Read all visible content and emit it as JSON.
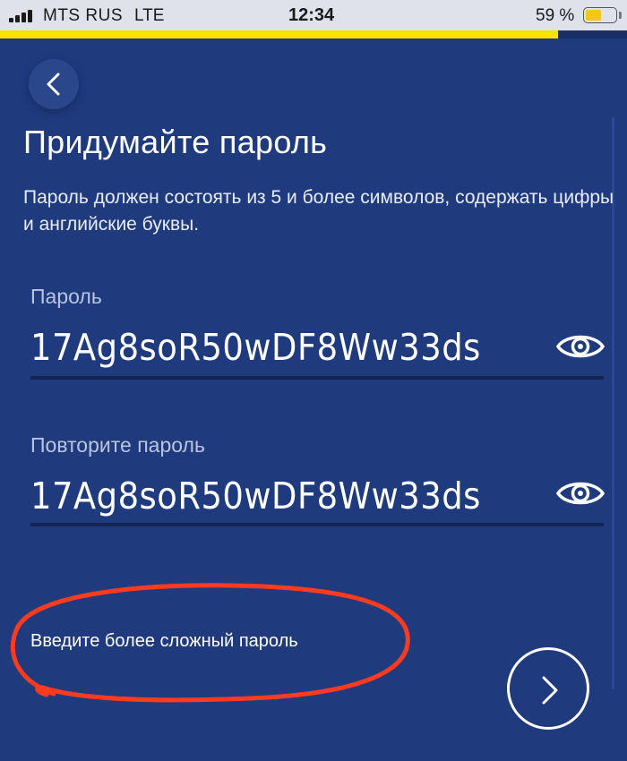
{
  "status_bar": {
    "carrier": "MTS RUS",
    "network": "LTE",
    "time": "12:34",
    "battery_percent": "59 %",
    "battery_level": 0.59
  },
  "progress": {
    "fraction": 0.89
  },
  "colors": {
    "background": "#1f3b7e",
    "accent": "#ffe200",
    "annotation": "#ff3b1f"
  },
  "back_button": {
    "icon": "chevron-left-icon"
  },
  "screen": {
    "title": "Придумайте пароль",
    "hint": "Пароль должен состоять из 5 и более символов, содержать цифры и английские буквы."
  },
  "password_field": {
    "label": "Пароль",
    "value": "17Ag8soR50wDF8Ww33ds",
    "toggle_icon": "eye-icon"
  },
  "repeat_field": {
    "label": "Повторите пароль",
    "value": "17Ag8soR50wDF8Ww33ds",
    "toggle_icon": "eye-icon"
  },
  "error": {
    "message": "Введите более сложный пароль"
  },
  "next_button": {
    "icon": "chevron-right-icon"
  }
}
